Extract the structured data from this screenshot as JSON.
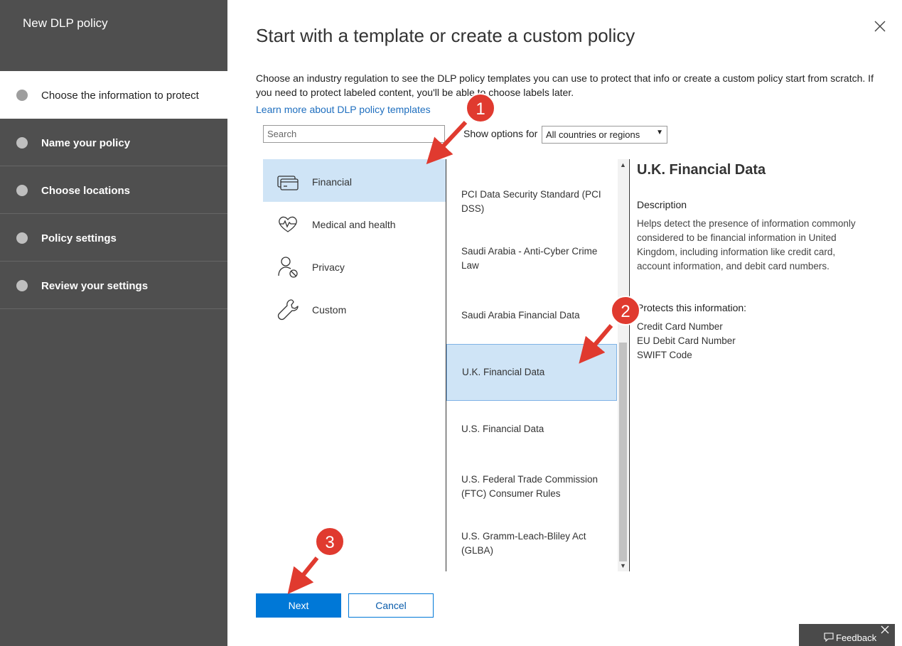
{
  "wizard": {
    "title": "New DLP policy",
    "steps": [
      {
        "label": "Choose the information to protect",
        "active": true
      },
      {
        "label": "Name your policy",
        "active": false
      },
      {
        "label": "Choose locations",
        "active": false
      },
      {
        "label": "Policy settings",
        "active": false
      },
      {
        "label": "Review your settings",
        "active": false
      }
    ]
  },
  "main": {
    "title": "Start with a template or create a custom policy",
    "intro": "Choose an industry regulation to see the DLP policy templates you can use to protect that info or create a custom policy start from scratch. If you need to protect labeled content, you'll be able to choose labels later.",
    "learn_more": "Learn more about DLP policy templates",
    "search": {
      "placeholder": "Search",
      "value": ""
    },
    "show_options_label": "Show options for",
    "region_select": {
      "value": "All countries or regions",
      "arrow": "▼"
    }
  },
  "categories": [
    {
      "label": "Financial",
      "icon": "credit-card-icon",
      "selected": true
    },
    {
      "label": "Medical and health",
      "icon": "heart-pulse-icon",
      "selected": false
    },
    {
      "label": "Privacy",
      "icon": "user-blocked-icon",
      "selected": false
    },
    {
      "label": "Custom",
      "icon": "wrench-icon",
      "selected": false
    }
  ],
  "templates": [
    {
      "label": "PCI Data Security Standard (PCI DSS)",
      "selected": false
    },
    {
      "label": "Saudi Arabia - Anti-Cyber Crime Law",
      "selected": false
    },
    {
      "label": "Saudi Arabia Financial Data",
      "selected": false
    },
    {
      "label": "U.K. Financial Data",
      "selected": true
    },
    {
      "label": "U.S. Financial Data",
      "selected": false
    },
    {
      "label": "U.S. Federal Trade Commission (FTC) Consumer Rules",
      "selected": false
    },
    {
      "label": "U.S. Gramm-Leach-Bliley Act (GLBA)",
      "selected": false
    }
  ],
  "details": {
    "title": "U.K. Financial Data",
    "description_heading": "Description",
    "description": "Helps detect the presence of information commonly considered to be financial information in United Kingdom, including information like credit card, account information, and debit card numbers.",
    "protects_heading": "Protects this information:",
    "protects": [
      "Credit Card Number",
      "EU Debit Card Number",
      "SWIFT Code"
    ]
  },
  "buttons": {
    "next": "Next",
    "cancel": "Cancel"
  },
  "feedback": {
    "label": "Feedback"
  },
  "annotations": [
    {
      "number": "1"
    },
    {
      "number": "2"
    },
    {
      "number": "3"
    }
  ],
  "colors": {
    "sidebar": "#4f4f4f",
    "accent": "#0078d7",
    "selection": "#cfe4f6",
    "annotation": "#e03a2f"
  }
}
